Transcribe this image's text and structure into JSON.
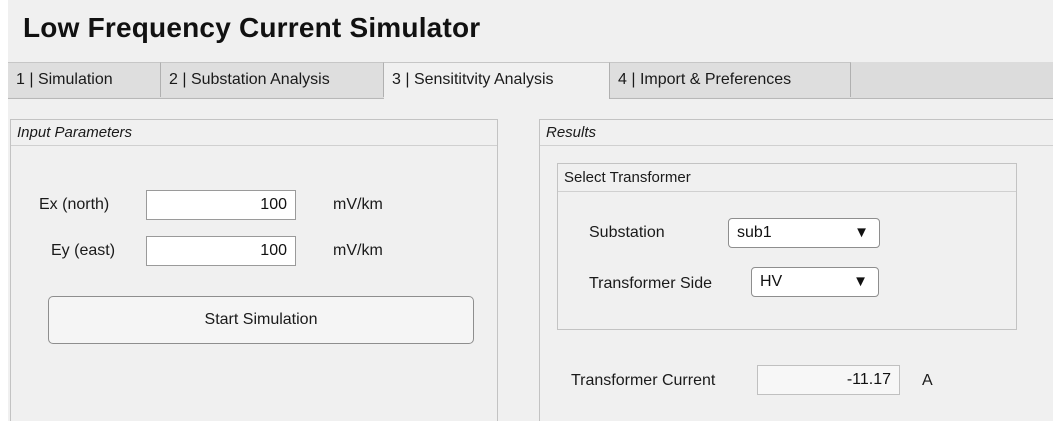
{
  "app": {
    "title": "Low Frequency Current Simulator"
  },
  "tabs": [
    {
      "label": "1 | Simulation",
      "active": false
    },
    {
      "label": "2 | Substation Analysis",
      "active": false
    },
    {
      "label": "3 | Sensititvity Analysis",
      "active": true
    },
    {
      "label": "4 | Import & Preferences",
      "active": false
    }
  ],
  "input_parameters": {
    "title": "Input Parameters",
    "ex": {
      "label": "Ex (north)",
      "value": "100",
      "unit": "mV/km"
    },
    "ey": {
      "label": "Ey (east)",
      "value": "100",
      "unit": "mV/km"
    },
    "start_button": "Start Simulation"
  },
  "results": {
    "title": "Results",
    "select_transformer": {
      "title": "Select Transformer",
      "substation": {
        "label": "Substation",
        "value": "sub1"
      },
      "side": {
        "label": "Transformer Side",
        "value": "HV"
      }
    },
    "current": {
      "label": "Transformer Current",
      "value": "-11.17",
      "unit": "A"
    }
  },
  "icons": {
    "dropdown_arrow": "▼"
  }
}
